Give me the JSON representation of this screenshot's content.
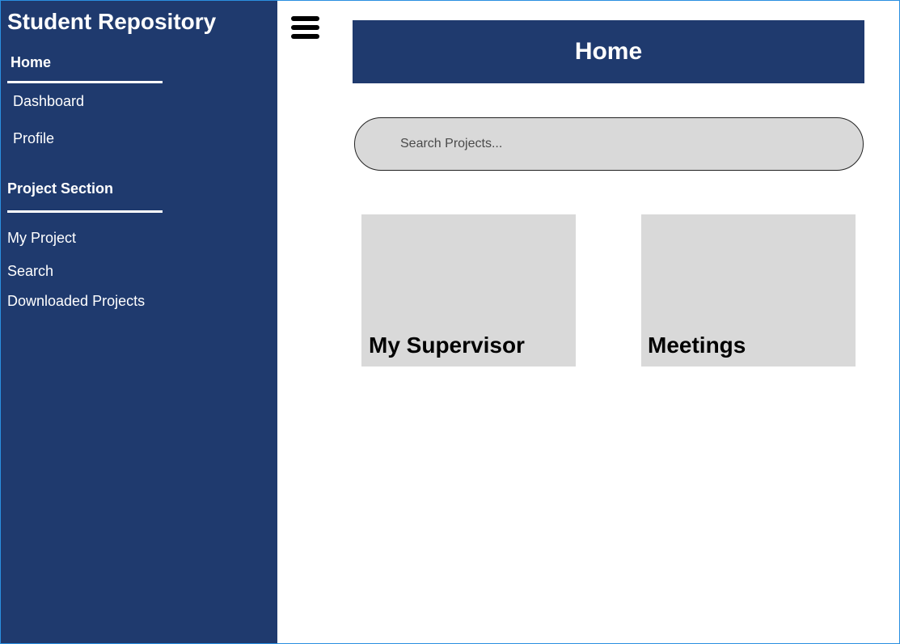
{
  "sidebar": {
    "app_title": "Student Repository",
    "home_section": {
      "title": "Home",
      "items": [
        "Dashboard",
        "Profile"
      ]
    },
    "project_section": {
      "title": "Project Section",
      "items": [
        "My Project",
        "Search",
        "Downloaded Projects"
      ]
    }
  },
  "main": {
    "menu_icon": "hamburger-menu-icon",
    "header_title": "Home",
    "search": {
      "placeholder": "Search Projects...",
      "value": ""
    },
    "cards": [
      {
        "title": "My Supervisor"
      },
      {
        "title": "Meetings"
      }
    ]
  },
  "colors": {
    "sidebar_bg": "#1f3a6e",
    "header_bg": "#1f3a6e",
    "card_bg": "#d9d9d9",
    "search_bg": "#d9d9d9",
    "frame_border": "#2a8fe0"
  }
}
